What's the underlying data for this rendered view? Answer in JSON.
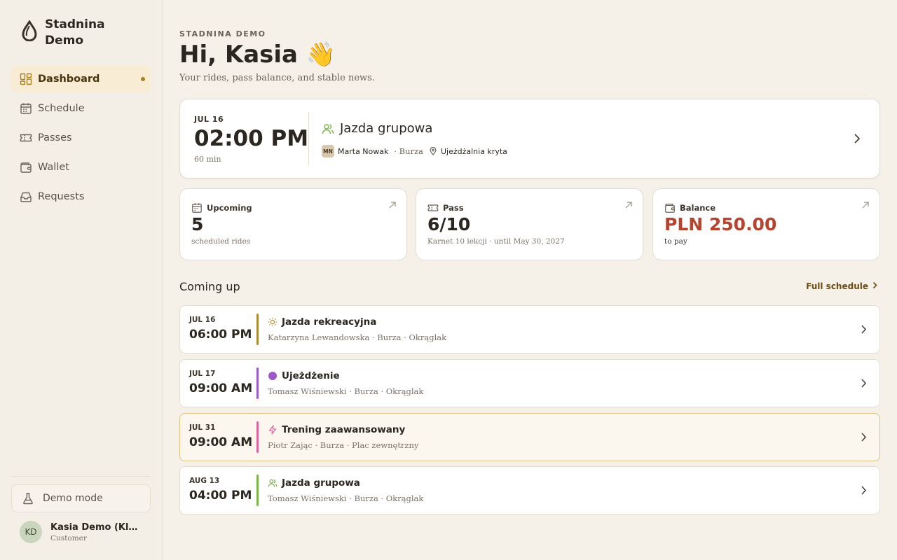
{
  "sidebar": {
    "brand": {
      "name": "Stadnina Demo",
      "line1": "Stadnina",
      "line2": "Demo"
    },
    "items": [
      {
        "label": "Dashboard",
        "icon": "dashboard-icon",
        "active": true
      },
      {
        "label": "Schedule",
        "icon": "calendar-icon",
        "active": false
      },
      {
        "label": "Passes",
        "icon": "ticket-icon",
        "active": false
      },
      {
        "label": "Wallet",
        "icon": "wallet-icon",
        "active": false
      },
      {
        "label": "Requests",
        "icon": "inbox-icon",
        "active": false
      }
    ],
    "demo_mode": "Demo mode",
    "user": {
      "initials": "KD",
      "name": "Kasia Demo (Klie...",
      "role": "Customer"
    }
  },
  "header": {
    "eyebrow": "STADNINA DEMO",
    "title": "Hi, Kasia 👋",
    "subtitle": "Your rides, pass balance, and stable news."
  },
  "next_ride": {
    "date": "JUL 16",
    "time": "02:00 PM",
    "duration": "60 min",
    "title": "Jazda grupowa",
    "instructor_initials": "MN",
    "instructor": "Marta Nowak",
    "horse": "· Burza",
    "location": "Ujeżdżalnia kryta"
  },
  "stats": {
    "upcoming": {
      "label": "Upcoming",
      "value": "5",
      "sub": "scheduled rides"
    },
    "pass": {
      "label": "Pass",
      "value": "6/10",
      "sub": "Karnet 10 lekcji · until May 30, 2027"
    },
    "balance": {
      "label": "Balance",
      "value": "PLN 250.00",
      "sub": "to pay"
    }
  },
  "coming_up": {
    "title": "Coming up",
    "full_link": "Full schedule",
    "rows": [
      {
        "date": "JUL 16",
        "time": "06:00 PM",
        "title": "Jazda rekreacyjna",
        "sub": "Katarzyna Lewandowska · Burza · Okrąglak",
        "color": "#b08a2e",
        "icon": "sun-icon"
      },
      {
        "date": "JUL 17",
        "time": "09:00 AM",
        "title": "Ujeżdżenie",
        "sub": "Tomasz Wiśniewski · Burza · Okrąglak",
        "color": "#9b59c9",
        "icon": "dot-icon"
      },
      {
        "date": "JUL 31",
        "time": "09:00 AM",
        "title": "Trening zaawansowany",
        "sub": "Piotr Zając · Burza · Plac zewnętrzny",
        "color": "#e0649a",
        "icon": "bolt-icon"
      },
      {
        "date": "AUG 13",
        "time": "04:00 PM",
        "title": "Jazda grupowa",
        "sub": "Tomasz Wiśniewski · Burza · Okrąglak",
        "color": "#7ab648",
        "icon": "users-icon"
      }
    ]
  },
  "colors": {
    "accent": "#a8801e",
    "active_bg": "#f8ecd4",
    "balance_red": "#b5432e",
    "background": "#f5f1e9"
  }
}
